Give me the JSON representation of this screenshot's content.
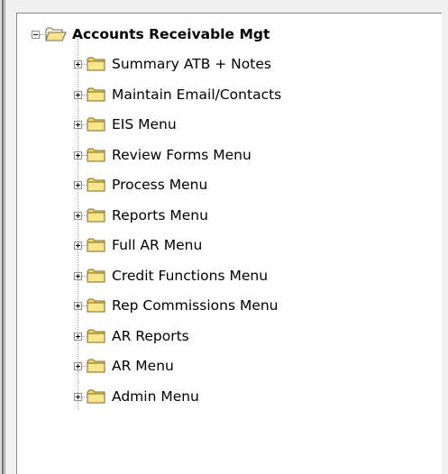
{
  "tree": {
    "root": {
      "label": "Accounts Receivable Mgt",
      "expanded": true,
      "icon": "folder-open-icon"
    },
    "children": [
      {
        "label": "Summary ATB + Notes",
        "icon": "folder-icon",
        "expanded": false
      },
      {
        "label": "Maintain Email/Contacts",
        "icon": "folder-icon",
        "expanded": false
      },
      {
        "label": "EIS Menu",
        "icon": "folder-icon",
        "expanded": false
      },
      {
        "label": "Review Forms Menu",
        "icon": "folder-icon",
        "expanded": false
      },
      {
        "label": "Process Menu",
        "icon": "folder-icon",
        "expanded": false
      },
      {
        "label": "Reports Menu",
        "icon": "folder-icon",
        "expanded": false
      },
      {
        "label": "Full AR Menu",
        "icon": "folder-icon",
        "expanded": false
      },
      {
        "label": "Credit Functions Menu",
        "icon": "folder-icon",
        "expanded": false
      },
      {
        "label": "Rep Commissions Menu",
        "icon": "folder-icon",
        "expanded": false
      },
      {
        "label": "AR Reports",
        "icon": "folder-icon",
        "expanded": false
      },
      {
        "label": "AR Menu",
        "icon": "folder-icon",
        "expanded": false
      },
      {
        "label": "Admin Menu",
        "icon": "folder-icon",
        "expanded": false
      }
    ]
  }
}
